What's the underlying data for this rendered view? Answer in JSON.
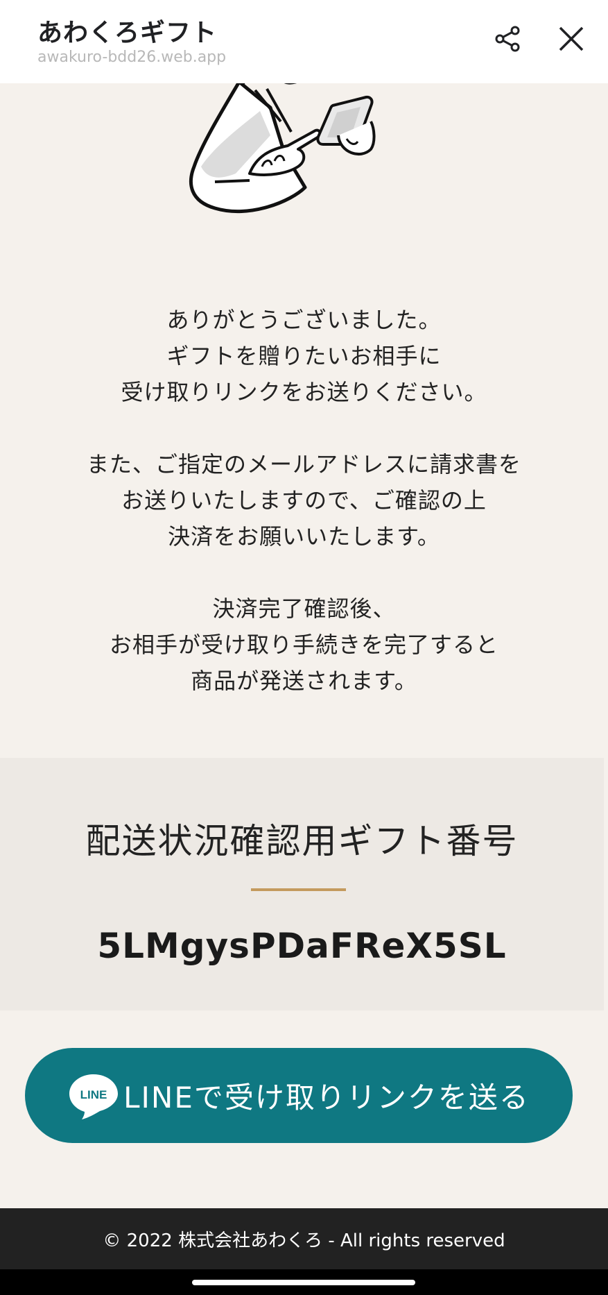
{
  "header": {
    "title": "あわくろギフト",
    "url": "awakuro-bdd26.web.app",
    "share_icon": "share-icon",
    "close_icon": "close-icon"
  },
  "illustration": {
    "icon": "person-holding-phone-illustration"
  },
  "message": {
    "paragraph1": [
      "ありがとうございました。",
      "ギフトを贈りたいお相手に",
      "受け取りリンクをお送りください。"
    ],
    "paragraph2": [
      "また、ご指定のメールアドレスに請求書を",
      "お送りいたしますので、ご確認の上",
      "決済をお願いいたします。"
    ],
    "paragraph3": [
      "決済完了確認後、",
      "お相手が受け取り手続きを完了すると",
      "商品が発送されます。"
    ]
  },
  "gift": {
    "heading": "配送状況確認用ギフト番号",
    "code": "5LMgysPDaFReX5SL",
    "divider_color": "#c49a5e"
  },
  "line_button": {
    "label": "LINEで受け取りリンクを送る",
    "icon_text": "LINE",
    "color": "#0f7882"
  },
  "footer": {
    "text": "© 2022 株式会社あわくろ - All rights reserved"
  }
}
